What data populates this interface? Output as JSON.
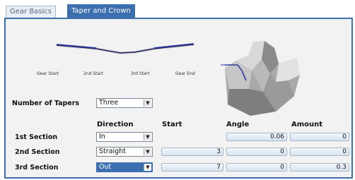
{
  "tabs": [
    {
      "label": "Gear Basics",
      "active": false
    },
    {
      "label": "Taper and Crown",
      "active": true
    }
  ],
  "profile": {
    "markers": [
      "Gear Start",
      "2nd Start",
      "3rd Start",
      "Gear End"
    ],
    "line_colors": {
      "dark": "#1a1a5a",
      "accent": "#2e3a9a"
    }
  },
  "taper_count": {
    "label": "Number of Tapers",
    "value": "Three"
  },
  "columns": [
    "Direction",
    "Start",
    "Angle",
    "Amount"
  ],
  "sections": [
    {
      "label": "1st Section",
      "direction": "In",
      "start": "",
      "angle": "0.06",
      "amount": "0",
      "selected": false
    },
    {
      "label": "2nd Section",
      "direction": "Straight",
      "start": "3",
      "angle": "0",
      "amount": "0",
      "selected": false
    },
    {
      "label": "3rd Section",
      "direction": "Out",
      "start": "7",
      "angle": "0",
      "amount": "0.3",
      "selected": true
    }
  ],
  "colors": {
    "accent": "#3b6fb0",
    "panel": "#f2f2f2"
  }
}
